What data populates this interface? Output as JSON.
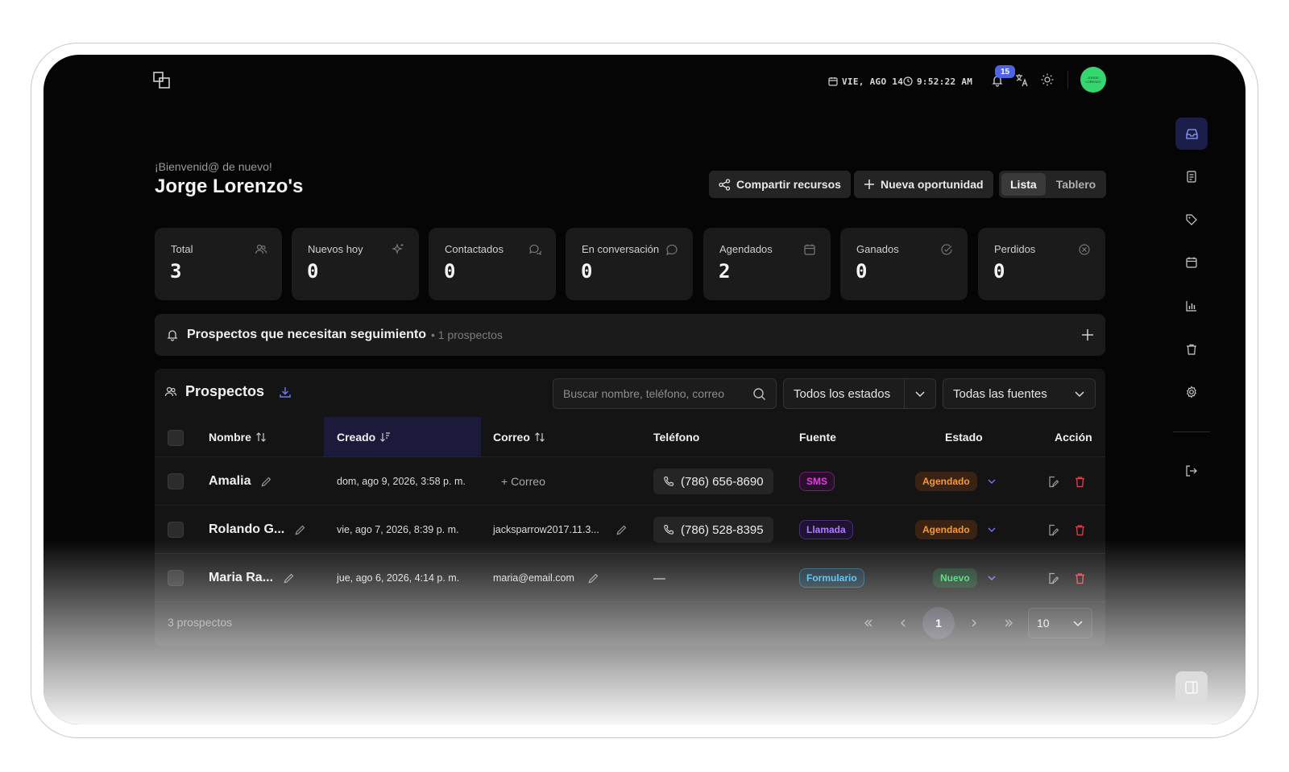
{
  "header": {
    "date": "VIE, AGO 14",
    "time": "9:52:22 AM",
    "notifications_count": "15",
    "avatar_text": "JORGE LORENZO"
  },
  "welcome": "¡Bienvenid@ de nuevo!",
  "title": "Jorge Lorenzo's",
  "actions": {
    "share": "Compartir recursos",
    "new_opportunity": "Nueva oportunidad",
    "view_list": "Lista",
    "view_board": "Tablero"
  },
  "stats": [
    {
      "label": "Total",
      "value": "3",
      "icon": "users-icon"
    },
    {
      "label": "Nuevos hoy",
      "value": "0",
      "icon": "sparkles-icon"
    },
    {
      "label": "Contactados",
      "value": "0",
      "icon": "chat-bubbles-icon"
    },
    {
      "label": "En conversación",
      "value": "0",
      "icon": "chat-bubble-icon"
    },
    {
      "label": "Agendados",
      "value": "2",
      "icon": "calendar-icon"
    },
    {
      "label": "Ganados",
      "value": "0",
      "icon": "check-circle-icon"
    },
    {
      "label": "Perdidos",
      "value": "0",
      "icon": "x-circle-icon"
    }
  ],
  "followup": {
    "title": "Prospectos que necesitan seguimiento",
    "subtitle": "• 1 prospectos"
  },
  "prospects": {
    "title": "Prospectos",
    "search_placeholder": "Buscar nombre, teléfono, correo",
    "status_filter": "Todos los estados",
    "source_filter": "Todas las fuentes",
    "columns": {
      "name": "Nombre",
      "created": "Creado",
      "email": "Correo",
      "phone": "Teléfono",
      "source": "Fuente",
      "status": "Estado",
      "action": "Acción"
    },
    "rows": [
      {
        "name": "Amalia",
        "created": "dom, ago 9, 2026, 3:58 p. m.",
        "email": "+ Correo",
        "phone": "(786) 656-8690",
        "source": "SMS",
        "status": "Agendado"
      },
      {
        "name": "Rolando G...",
        "created": "vie, ago 7, 2026, 8:39 p. m.",
        "email": "jacksparrow2017.11.3...",
        "phone": "(786) 528-8395",
        "source": "Llamada",
        "status": "Agendado"
      },
      {
        "name": "Maria Ra...",
        "created": "jue, ago 6, 2026, 4:14 p. m.",
        "email": "maria@email.com",
        "phone": "—",
        "source": "Formulario",
        "status": "Nuevo"
      }
    ],
    "footer_count": "3 prospectos",
    "current_page": "1",
    "page_size": "10"
  },
  "colors": {
    "accent": "#4f63e6",
    "sms": "#e23ee6",
    "llamada": "#b07cff",
    "formulario": "#3fb6f0",
    "agendado": "#f39a3a",
    "nuevo": "#3ed06a",
    "delete": "#e0414e"
  }
}
